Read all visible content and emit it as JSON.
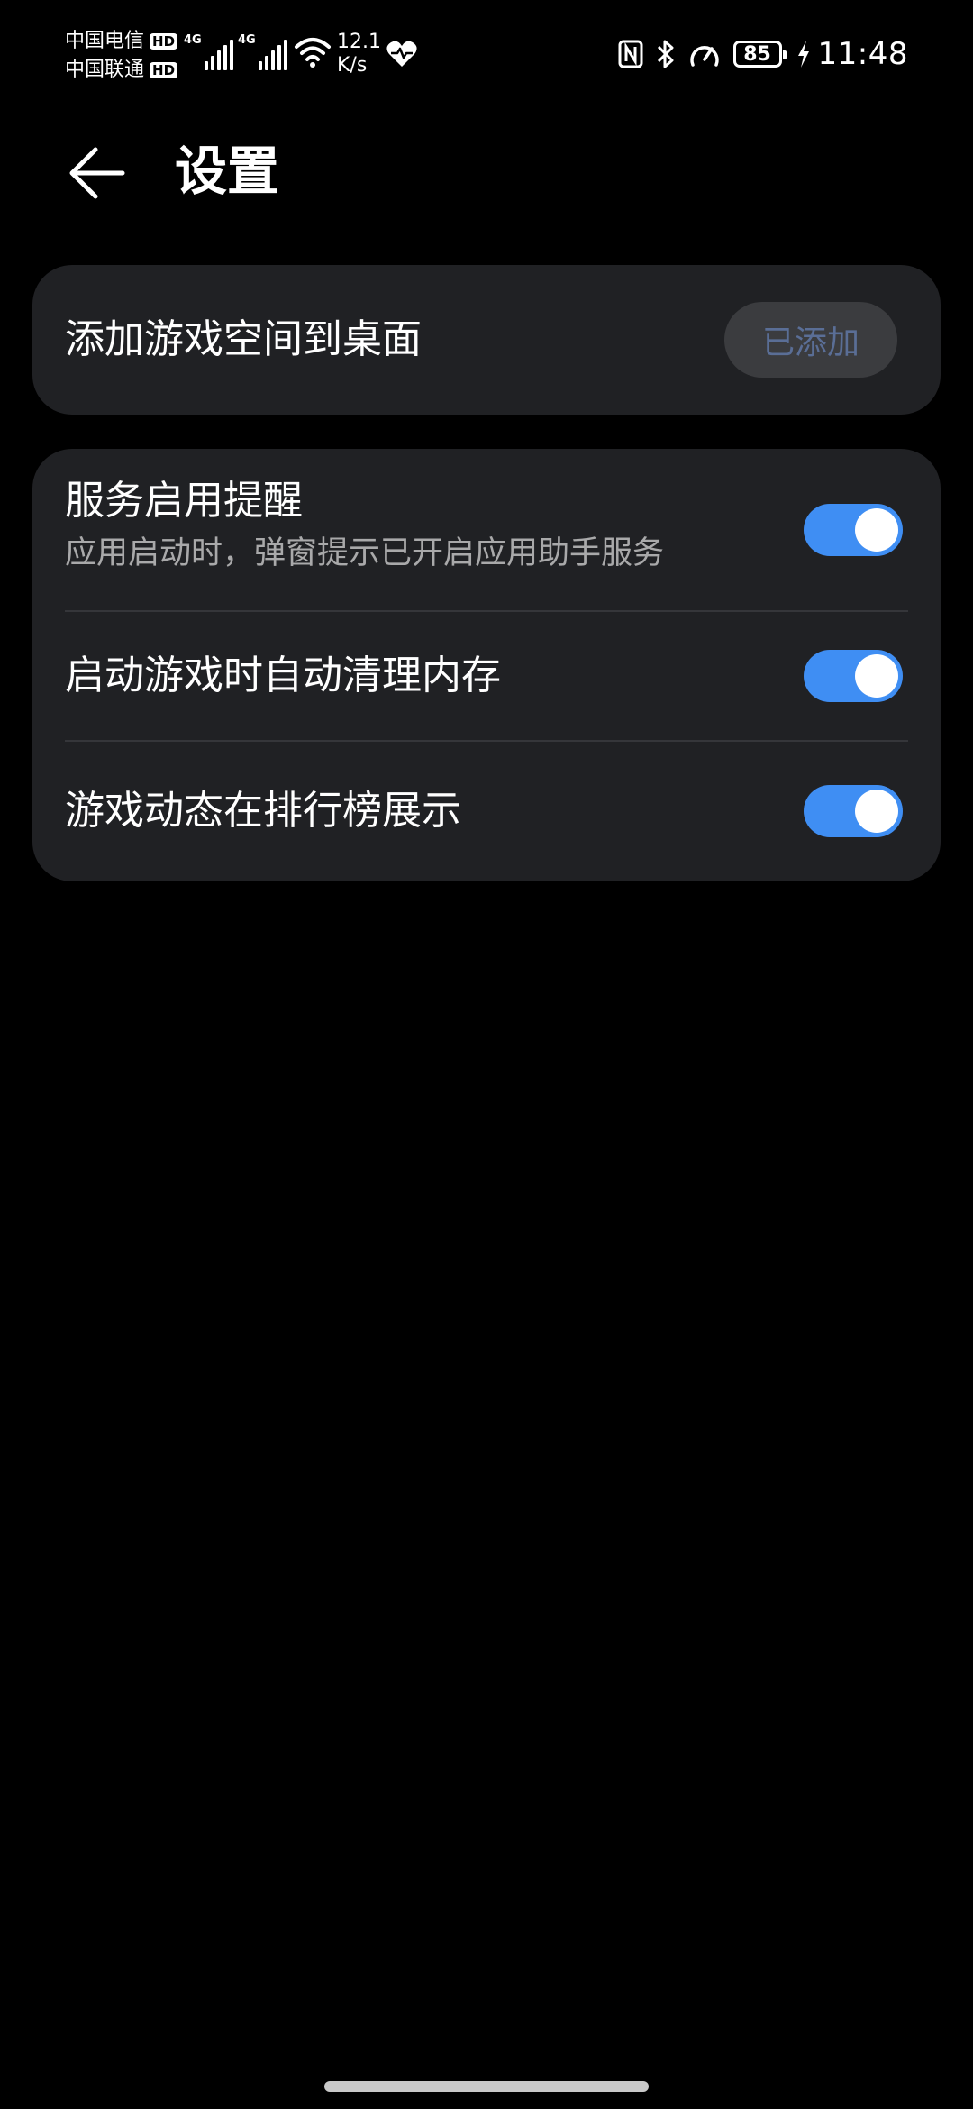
{
  "status_bar": {
    "carrier_1": "中国电信",
    "carrier_2": "中国联通",
    "hd_badge": "HD",
    "signal_1_tag": "4G",
    "signal_2_tag": "4G",
    "net_speed_value": "12.1",
    "net_speed_unit": "K/s",
    "battery_level": "85",
    "time": "11:48"
  },
  "header": {
    "title": "设置"
  },
  "add_card": {
    "label": "添加游戏空间到桌面",
    "button_label": "已添加"
  },
  "settings": {
    "items": [
      {
        "label": "服务启用提醒",
        "subtitle": "应用启动时，弹窗提示已开启应用助手服务",
        "enabled": true
      },
      {
        "label": "启动游戏时自动清理内存",
        "enabled": true
      },
      {
        "label": "游戏动态在排行榜展示",
        "enabled": true
      }
    ]
  },
  "colors": {
    "background": "#000000",
    "card": "#202124",
    "accent": "#3f8ef3",
    "subtitle_text": "#a9a9aa",
    "disabled_button_bg": "#3b3c3f",
    "disabled_button_text": "#5a6e96"
  }
}
